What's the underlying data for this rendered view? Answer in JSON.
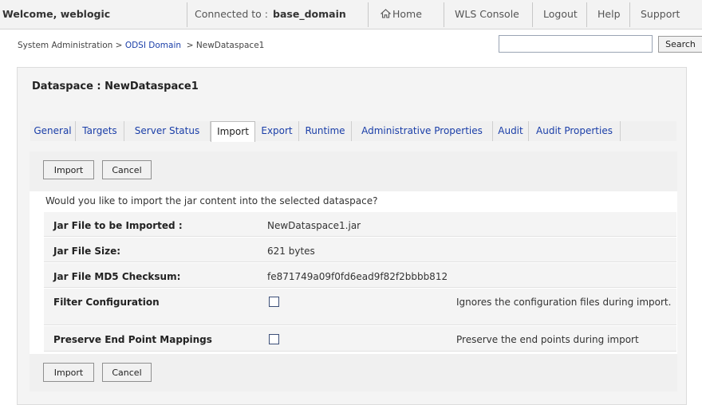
{
  "topbar": {
    "welcome": "Welcome, weblogic",
    "connected_label": "Connected to :",
    "domain": "base_domain",
    "links": [
      "Home",
      "WLS Console",
      "Logout",
      "Help",
      "Support"
    ]
  },
  "breadcrumb": {
    "root": "System Administration",
    "sep": ">",
    "middle": "ODSI Domain",
    "current": "NewDataspace1"
  },
  "search": {
    "value": "",
    "button": "Search"
  },
  "panel": {
    "title": "Dataspace : NewDataspace1"
  },
  "tabs": [
    "General",
    "Targets",
    "Server Status",
    "Import",
    "Export",
    "Runtime",
    "Administrative Properties",
    "Audit",
    "Audit Properties"
  ],
  "active_tab": "Import",
  "buttons": {
    "import": "Import",
    "cancel": "Cancel"
  },
  "question": "Would you like to import the jar content into the selected dataspace?",
  "fields": [
    {
      "label": "Jar File to be Imported :",
      "value": "NewDataspace1.jar"
    },
    {
      "label": "Jar File Size:",
      "value": "621 bytes"
    },
    {
      "label": "Jar File MD5 Checksum:",
      "value": "fe871749a09f0fd6ead9f82f2bbbb812"
    }
  ],
  "options": [
    {
      "label": "Filter Configuration",
      "checked": false,
      "description": "Ignores the configuration files during import."
    },
    {
      "label": "Preserve End Point Mappings",
      "checked": false,
      "description": "Preserve the end points during import"
    }
  ],
  "colors": {
    "link": "#1a3ea8",
    "panel_bg": "#f4f4f4",
    "topbar_bg": "#f3f3f3"
  },
  "icons": {
    "home": "home-icon"
  }
}
